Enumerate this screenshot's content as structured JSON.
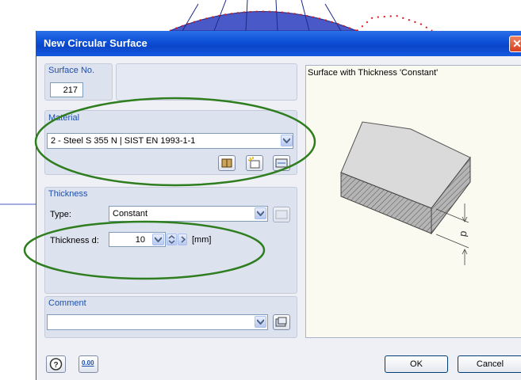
{
  "dialog": {
    "title": "New Circular Surface",
    "close_glyph": "✕"
  },
  "surface_no": {
    "label": "Surface No.",
    "value": "217"
  },
  "material": {
    "label": "Material",
    "selected": "2 - Steel S 355 N | SIST EN 1993-1-1"
  },
  "thickness": {
    "label": "Thickness",
    "type_label": "Type:",
    "type_value": "Constant",
    "d_label": "Thickness d:",
    "d_value": "10",
    "unit": "[mm]"
  },
  "comment": {
    "label": "Comment",
    "value": ""
  },
  "preview": {
    "caption": "Surface with Thickness 'Constant'",
    "dimension_label": "d"
  },
  "footer": {
    "ok_label": "OK",
    "cancel_label": "Cancel",
    "units_label": "0.00"
  },
  "colors": {
    "annotation_ellipse": "#2e7d1e",
    "title_bar": "#0c4fd6"
  },
  "icons": [
    "help-icon",
    "units-icon",
    "library-icon",
    "new-material-icon",
    "edit-material-icon",
    "thickness-edit-icon",
    "comment-edit-icon",
    "close-icon"
  ]
}
